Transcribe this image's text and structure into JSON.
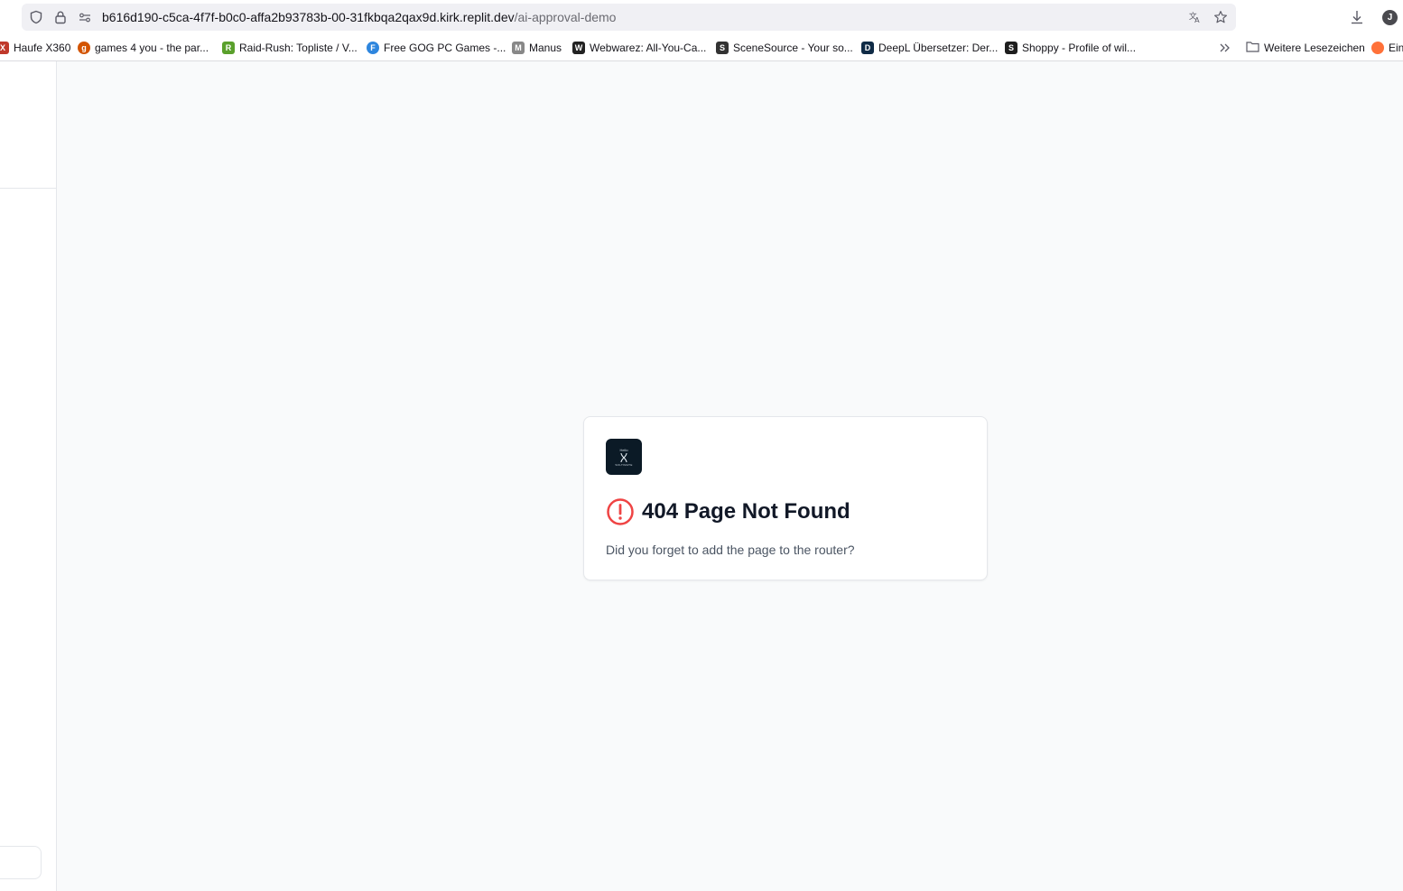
{
  "browser": {
    "url_host": "b616d190-c5ca-4f7f-b0c0-affa2b93783b-00-31fkbqa2qax9d.kirk.replit.dev",
    "url_path": "/ai-approval-demo",
    "profile_initial": "J",
    "bookmarks": [
      {
        "label": "Haufe X360",
        "color": "#c0392b",
        "glyph": "X"
      },
      {
        "label": "games 4 you - the par...",
        "color": "#d35400",
        "glyph": "g"
      },
      {
        "label": "Raid-Rush: Topliste / V...",
        "color": "#5aa02c",
        "glyph": "R"
      },
      {
        "label": "Free GOG PC Games -...",
        "color": "#2e86de",
        "glyph": "F"
      },
      {
        "label": "Manus",
        "color": "#555555",
        "glyph": "M"
      },
      {
        "label": "Webwarez: All-You-Ca...",
        "color": "#222222",
        "glyph": "W"
      },
      {
        "label": "SceneSource - Your so...",
        "color": "#333333",
        "glyph": "S"
      },
      {
        "label": "DeepL Übersetzer: Der...",
        "color": "#0f2b46",
        "glyph": "D"
      },
      {
        "label": "Shoppy - Profile of wil...",
        "color": "#1e1e1e",
        "glyph": "S"
      }
    ],
    "more_bookmarks_label": "Weitere Lesezeichen",
    "import_label": "Ein"
  },
  "card": {
    "logo_top_text": "Hello",
    "logo_bottom_text": "SOLTIMATE",
    "title": "404 Page Not Found",
    "message": "Did you forget to add the page to the router?",
    "alert_color": "#ef4444"
  }
}
